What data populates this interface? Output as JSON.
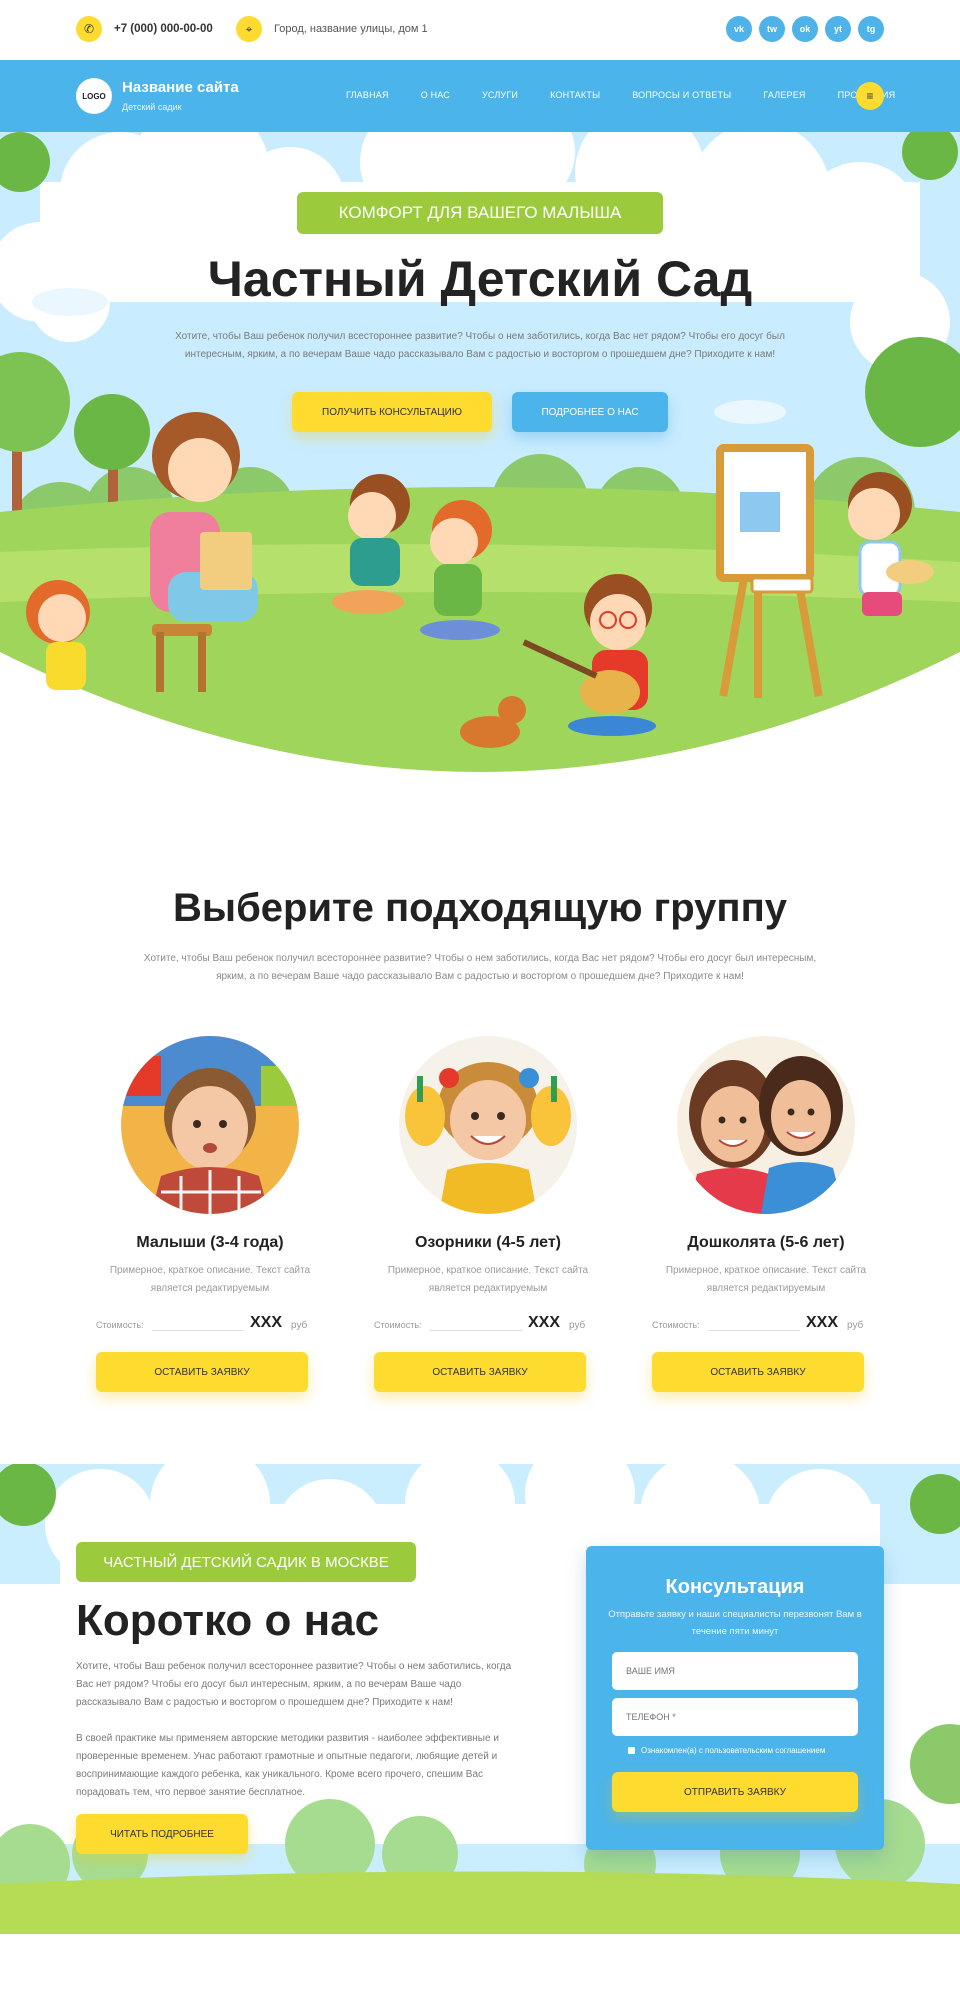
{
  "topbar": {
    "phone": "+7 (000) 000-00-00",
    "address": "Город, название улицы, дом 1",
    "phone_icon": "phone-icon",
    "location_icon": "location-icon",
    "socials": [
      "vk",
      "tw",
      "ok",
      "yt",
      "tg"
    ]
  },
  "nav": {
    "logo": "LOGO",
    "site_name": "Название сайта",
    "site_sub": "Детский садик",
    "menu": [
      "ГЛАВНАЯ",
      "О НАС",
      "УСЛУГИ",
      "КОНТАКТЫ",
      "ВОПРОСЫ И ОТВЕТЫ",
      "ГАЛЕРЕЯ",
      "ПРОДУКЦИЯ"
    ],
    "burger_icon": "menu-icon"
  },
  "hero": {
    "badge": "КОМФОРТ ДЛЯ ВАШЕГО МАЛЫША",
    "title": "Частный Детский Сад",
    "text": "Хотите, чтобы Ваш ребенок получил всестороннее развитие? Чтобы о нем заботились, когда Вас нет рядом? Чтобы его досуг был интересным, ярким, а по вечерам Ваше чадо рассказывало Вам с радостью и восторгом о прошедшем дне? Приходите к нам!",
    "btn_consult": "ПОЛУЧИТЬ КОНСУЛЬТАЦИЮ",
    "btn_more": "ПОДРОБНЕЕ О НАС"
  },
  "groups": {
    "title": "Выберите подходящую группу",
    "text": "Хотите, чтобы Ваш ребенок получил всестороннее развитие? Чтобы о нем заботились, когда Вас нет рядом? Чтобы его досуг был интересным, ярким, а по вечерам Ваше чадо рассказывало Вам с радостью и восторгом о прошедшем дне? Приходите к нам!",
    "items": [
      {
        "name": "Малыши (3-4 года)",
        "desc": "Примерное, краткое описание. Текст сайта является редактируемым",
        "price_label": "Стоимость:",
        "price": "XXX",
        "currency": "руб",
        "button": "ОСТАВИТЬ ЗАЯВКУ"
      },
      {
        "name": "Озорники (4-5 лет)",
        "desc": "Примерное, краткое описание. Текст сайта является редактируемым",
        "price_label": "Стоимость:",
        "price": "XXX",
        "currency": "руб",
        "button": "ОСТАВИТЬ ЗАЯВКУ"
      },
      {
        "name": "Дошколята (5-6 лет)",
        "desc": "Примерное, краткое описание. Текст сайта является редактируемым",
        "price_label": "Стоимость:",
        "price": "XXX",
        "currency": "руб",
        "button": "ОСТАВИТЬ ЗАЯВКУ"
      }
    ]
  },
  "about": {
    "badge": "ЧАСТНЫЙ ДЕТСКИЙ САДИК В МОСКВЕ",
    "title": "Коротко о нас",
    "p1": "Хотите, чтобы Ваш ребенок получил всестороннее развитие? Чтобы о нем заботились, когда Вас нет рядом? Чтобы его досуг был интересным, ярким, а по вечерам Ваше чадо рассказывало Вам с радостью и восторгом о прошедшем дне? Приходите к нам!",
    "p2": "В своей практике мы применяем авторские методики развития - наиболее эффективные и проверенные временем. Унас работают грамотные и опытные педагоги, любящие детей и воспринимающие каждого ребенка, как уникального. Кроме всего прочего, спешим Вас порадовать тем, что первое занятие бесплатное.",
    "button": "ЧИТАТЬ ПОДРОБНЕЕ"
  },
  "form": {
    "title": "Консультация",
    "sub": "Отправьте заявку и наши специалисты перезвонят Вам в течение пяти минут",
    "name_placeholder": "ВАШЕ ИМЯ",
    "phone_placeholder": "ТЕЛЕФОН *",
    "consent": "Ознакомлен(а) с пользовательским соглашением",
    "button": "ОТПРАВИТЬ ЗАЯВКУ"
  },
  "colors": {
    "accent_blue": "#4bb4ea",
    "accent_yellow": "#fddb2f",
    "accent_green": "#9bcb3c"
  }
}
